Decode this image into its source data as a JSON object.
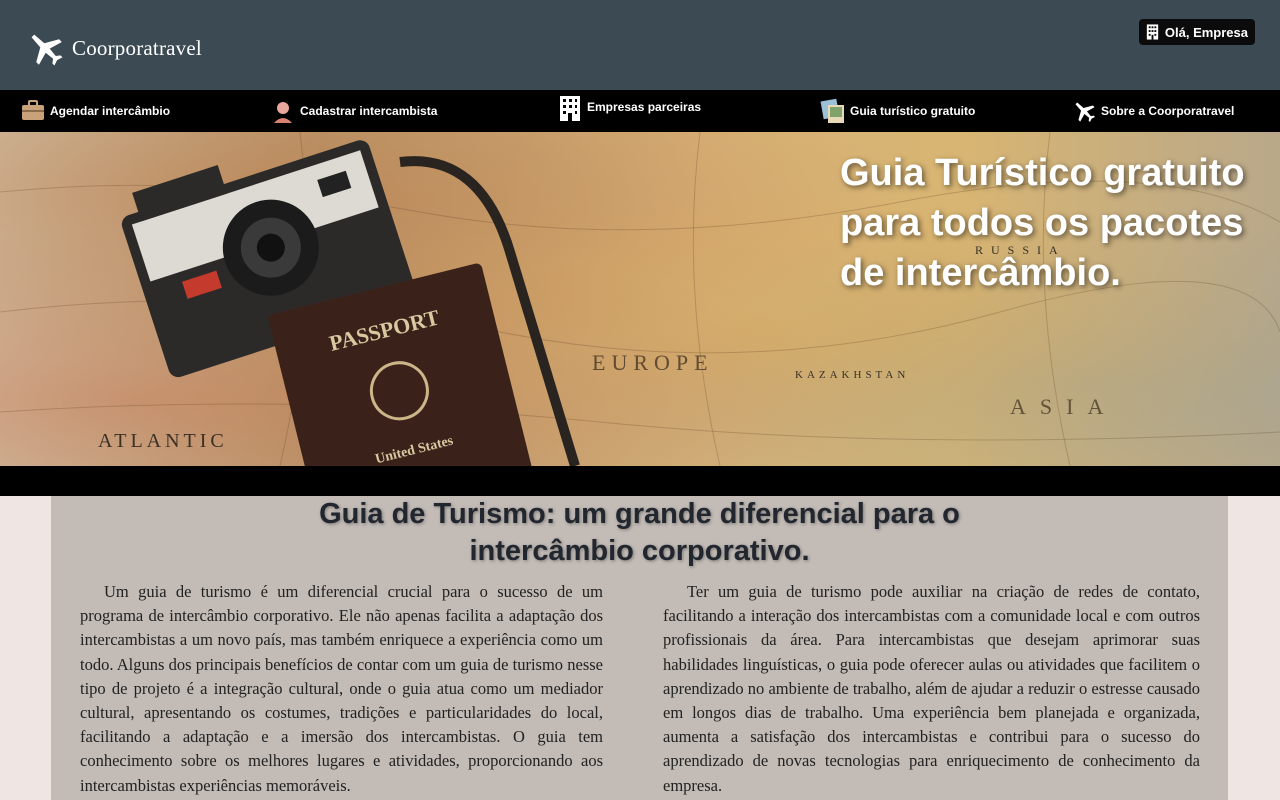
{
  "header": {
    "brand": "Coorporatravel",
    "greeting": "Olá, Empresa"
  },
  "nav": {
    "items": [
      {
        "label": "Agendar intercâmbio",
        "icon": "briefcase-icon"
      },
      {
        "label": "Cadastrar intercambista",
        "icon": "person-icon"
      },
      {
        "label": "Empresas parceiras",
        "icon": "building-icon"
      },
      {
        "label": "Guia turístico gratuito",
        "icon": "photos-icon"
      },
      {
        "label": "Sobre a Coorporatravel",
        "icon": "airplane-icon"
      }
    ]
  },
  "hero": {
    "title": "Guia Turístico gratuito para todos os pacotes de intercâmbio."
  },
  "article": {
    "heading_line1": "Guia de Turismo: um grande diferencial para o",
    "heading_line2": "intercâmbio corporativo.",
    "paragraph1": "Um guia de turismo é um diferencial crucial para o sucesso de um programa de intercâmbio corporativo. Ele não apenas facilita a adaptação dos intercambistas a um novo país, mas também enriquece a experiência como um todo. Alguns dos principais benefícios de contar com um guia de turismo nesse tipo de projeto é a integração cultural, onde o guia atua como um mediador cultural, apresentando os costumes, tradições e particularidades do local, facilitando a adaptação e a imersão dos intercambistas. O guia tem conhecimento sobre os melhores lugares e atividades, proporcionando aos intercambistas experiências memoráveis.",
    "paragraph2": "Ter um guia de turismo pode auxiliar na criação de redes de contato, facilitando a interação dos intercambistas com a comunidade local e com outros profissionais da área. Para intercambistas que desejam aprimorar suas habilidades linguísticas, o guia pode oferecer aulas ou atividades que facilitem o aprendizado no ambiente de trabalho, além de ajudar a reduzir o estresse causado em longos dias de trabalho. Uma experiência bem planejada e organizada, aumenta a satisfação dos intercambistas e contribui para o sucesso do aprendizado de novas tecnologias para enriquecimento de conhecimento da empresa."
  },
  "colors": {
    "header_bg": "#3c4a53",
    "nav_bg": "#000000",
    "content_bg": "#c2bbb6",
    "page_bg": "#efe6e3"
  }
}
